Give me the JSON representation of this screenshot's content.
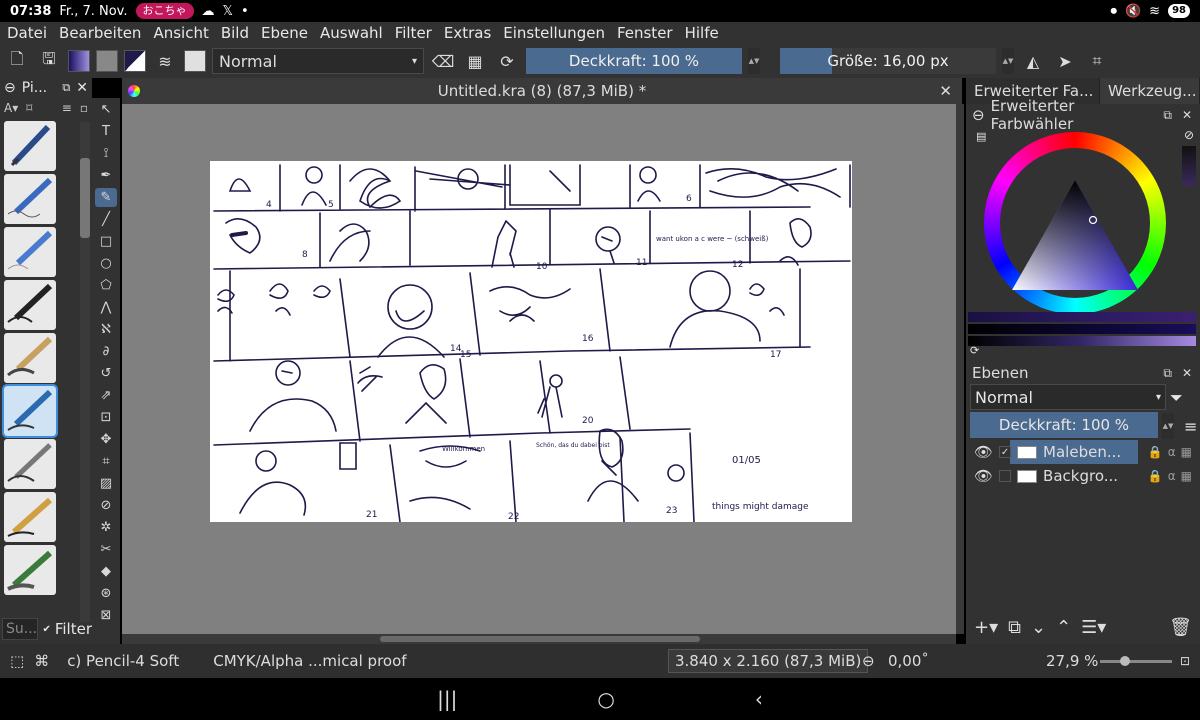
{
  "status": {
    "time": "07:38",
    "date": "Fr., 7. Nov.",
    "notif_pill": "おこちゃ",
    "battery": "98"
  },
  "menu": [
    "Datei",
    "Bearbeiten",
    "Ansicht",
    "Bild",
    "Ebene",
    "Auswahl",
    "Filter",
    "Extras",
    "Einstellungen",
    "Fenster",
    "Hilfe"
  ],
  "toolbar": {
    "blend_mode": "Normal",
    "opacity": "Deckkraft: 100 %",
    "size": "Größe: 16,00 px"
  },
  "left_dock": {
    "title": "Pi...",
    "search_placeholder": "Su...",
    "filter_label": "Filter"
  },
  "document": {
    "title": "Untitled.kra (8) (87,3 MiB) *"
  },
  "right_dock": {
    "tabs": [
      "Erweiterter Fa...",
      "Werkzeug..."
    ],
    "color_title": "Erweiterter Farbwähler",
    "layers_title": "Ebenen",
    "layer_blend": "Normal",
    "layer_opacity": "Deckkraft:  100 %",
    "layers": [
      {
        "name": "Maleben...",
        "selected": true
      },
      {
        "name": "Backgro...",
        "selected": false
      }
    ]
  },
  "statusbar": {
    "brush": "c) Pencil-4 Soft",
    "colorspace": "CMYK/Alpha ...mical proof",
    "dimensions": "3.840 x 2.160 (87,3 MiB)",
    "rotation": "0,00˚",
    "zoom": "27,9 %"
  },
  "canvas_sketch": {
    "panel_numbers": [
      "4",
      "5",
      "6",
      "8",
      "10",
      "11",
      "12",
      "14",
      "15",
      "16",
      "17",
      "20",
      "21",
      "22",
      "23"
    ],
    "notes": [
      "want ukon a c were ~ (schweiß)",
      "Willkommen",
      "Schön, das du dabei bist",
      "01/05",
      "things might damage"
    ]
  },
  "colors": {
    "accent": "#4a6a8f",
    "panel": "#323232",
    "canvas_bg": "#808080",
    "ink": "#1e1a4a"
  }
}
